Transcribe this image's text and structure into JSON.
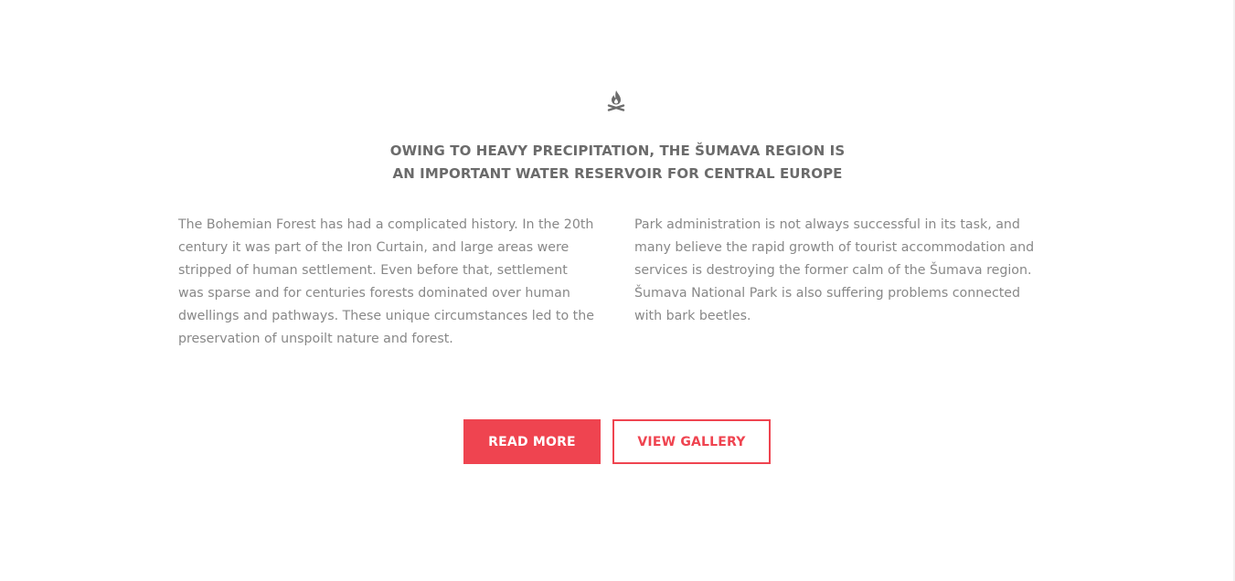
{
  "section": {
    "icon": "campfire-icon",
    "icon_color": "#6b6b6b",
    "heading_lines": [
      "OWING TO HEAVY PRECIPITATION, THE ŠUMAVA REGION IS",
      "AN IMPORTANT WATER RESERVOIR FOR CENTRAL EUROPE"
    ],
    "left_paragraph_lines": [
      "The Bohemian Forest has had a complicated history. In the 20th",
      "century it was part of the Iron Curtain, and large areas were",
      "stripped of human settlement. Even before that, settlement",
      "was sparse and for centuries forests dominated over human",
      "dwellings and pathways. These unique circumstances led to the",
      "preservation of unspoilt nature and forest."
    ],
    "right_paragraph_lines": [
      "Park administration is not always successful in its task, and",
      "many believe the rapid growth of tourist accommodation and",
      "services is destroying the former calm of the Šumava region.",
      "Šumava National Park is also suffering problems connected",
      "with bark beetles."
    ]
  },
  "buttons": {
    "read_more_label": "READ MORE",
    "view_gallery_label": "VIEW GALLERY"
  },
  "colors": {
    "accent": "#ef4450",
    "heading": "#6b6b6b",
    "body_text": "#888888",
    "background": "#ffffff"
  }
}
